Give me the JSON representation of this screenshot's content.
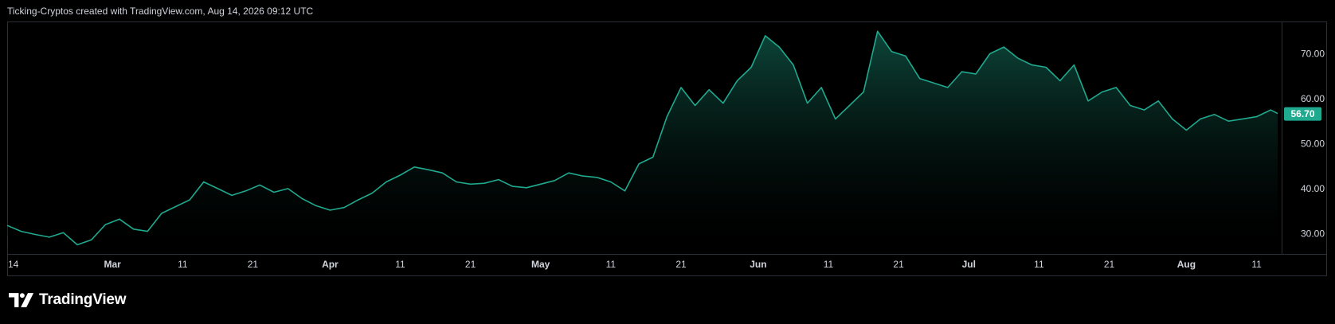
{
  "header": {
    "caption": "Ticking-Cryptos created with TradingView.com, Aug 14, 2026 09:12 UTC"
  },
  "brand": {
    "name": "TradingView",
    "logo_icon": "tradingview-logo-icon"
  },
  "colors": {
    "background": "#000000",
    "line": "#1fa98f",
    "fill_top": "#0d4a3d",
    "fill_bottom": "#000000",
    "axis_text": "#d1d4dc",
    "price_label_bg": "#1fa98f",
    "price_label_text": "#ffffff",
    "frame": "#2a2e39"
  },
  "chart_data": {
    "type": "area",
    "title": "",
    "xlabel": "",
    "ylabel": "",
    "x_range": [
      "2026-02-14",
      "2026-08-14"
    ],
    "ylim": [
      26,
      77
    ],
    "grid": false,
    "legend": "none",
    "price_scale_side": "right",
    "last_price_label": "56.70",
    "x_tick_labels": [
      {
        "date": "2026-02-14",
        "label": "14"
      },
      {
        "date": "2026-03-01",
        "label": "Mar"
      },
      {
        "date": "2026-03-11",
        "label": "11"
      },
      {
        "date": "2026-03-21",
        "label": "21"
      },
      {
        "date": "2026-04-01",
        "label": "Apr"
      },
      {
        "date": "2026-04-11",
        "label": "11"
      },
      {
        "date": "2026-04-21",
        "label": "21"
      },
      {
        "date": "2026-05-01",
        "label": "May"
      },
      {
        "date": "2026-05-11",
        "label": "11"
      },
      {
        "date": "2026-05-21",
        "label": "21"
      },
      {
        "date": "2026-06-01",
        "label": "Jun"
      },
      {
        "date": "2026-06-11",
        "label": "11"
      },
      {
        "date": "2026-06-21",
        "label": "21"
      },
      {
        "date": "2026-07-01",
        "label": "Jul"
      },
      {
        "date": "2026-07-11",
        "label": "11"
      },
      {
        "date": "2026-07-21",
        "label": "21"
      },
      {
        "date": "2026-08-01",
        "label": "Aug"
      },
      {
        "date": "2026-08-11",
        "label": "11"
      }
    ],
    "y_tick_labels": [
      {
        "value": 70,
        "label": "70.00"
      },
      {
        "value": 60,
        "label": "60.00"
      },
      {
        "value": 50,
        "label": "50.00"
      },
      {
        "value": 40,
        "label": "40.00"
      },
      {
        "value": 30,
        "label": "30.00"
      }
    ],
    "series": [
      {
        "x": [
          "2026-02-14",
          "2026-02-16",
          "2026-02-18",
          "2026-02-20",
          "2026-02-22",
          "2026-02-24",
          "2026-02-26",
          "2026-02-28",
          "2026-03-02",
          "2026-03-04",
          "2026-03-06",
          "2026-03-08",
          "2026-03-10",
          "2026-03-12",
          "2026-03-14",
          "2026-03-16",
          "2026-03-18",
          "2026-03-20",
          "2026-03-22",
          "2026-03-24",
          "2026-03-26",
          "2026-03-28",
          "2026-03-30",
          "2026-04-01",
          "2026-04-03",
          "2026-04-05",
          "2026-04-07",
          "2026-04-09",
          "2026-04-11",
          "2026-04-13",
          "2026-04-15",
          "2026-04-17",
          "2026-04-19",
          "2026-04-21",
          "2026-04-23",
          "2026-04-25",
          "2026-04-27",
          "2026-04-29",
          "2026-05-01",
          "2026-05-03",
          "2026-05-05",
          "2026-05-07",
          "2026-05-09",
          "2026-05-11",
          "2026-05-13",
          "2026-05-15",
          "2026-05-17",
          "2026-05-19",
          "2026-05-21",
          "2026-05-23",
          "2026-05-25",
          "2026-05-27",
          "2026-05-29",
          "2026-05-31",
          "2026-06-02",
          "2026-06-04",
          "2026-06-06",
          "2026-06-08",
          "2026-06-10",
          "2026-06-12",
          "2026-06-14",
          "2026-06-16",
          "2026-06-18",
          "2026-06-20",
          "2026-06-22",
          "2026-06-24",
          "2026-06-26",
          "2026-06-28",
          "2026-06-30",
          "2026-07-02",
          "2026-07-04",
          "2026-07-06",
          "2026-07-08",
          "2026-07-10",
          "2026-07-12",
          "2026-07-14",
          "2026-07-16",
          "2026-07-18",
          "2026-07-20",
          "2026-07-22",
          "2026-07-24",
          "2026-07-26",
          "2026-07-28",
          "2026-07-30",
          "2026-08-01",
          "2026-08-03",
          "2026-08-05",
          "2026-08-07",
          "2026-08-09",
          "2026-08-11",
          "2026-08-13",
          "2026-08-14"
        ],
        "values": [
          31.8,
          30.5,
          29.8,
          29.2,
          30.2,
          27.5,
          28.6,
          32.0,
          33.2,
          31.0,
          30.5,
          34.5,
          36.0,
          37.5,
          41.5,
          40.0,
          38.5,
          39.5,
          40.8,
          39.2,
          40.0,
          37.8,
          36.2,
          35.2,
          35.8,
          37.5,
          39.0,
          41.5,
          43.0,
          44.8,
          44.2,
          43.5,
          41.5,
          41.0,
          41.2,
          42.0,
          40.5,
          40.2,
          41.0,
          41.8,
          43.5,
          42.8,
          42.5,
          41.5,
          39.5,
          45.5,
          47.0,
          56.0,
          62.5,
          58.5,
          62.0,
          59.0,
          64.0,
          67.0,
          74.0,
          71.5,
          67.5,
          59.0,
          62.5,
          55.5,
          58.5,
          61.5,
          75.0,
          70.5,
          69.5,
          64.5,
          63.5,
          62.5,
          66.0,
          65.5,
          70.0,
          71.5,
          69.0,
          67.5,
          67.0,
          64.0,
          67.5,
          59.5,
          61.5,
          62.5,
          58.5,
          57.5,
          59.5,
          55.5,
          53.0,
          55.5,
          56.5,
          55.0,
          55.5,
          56.0,
          57.5,
          56.7
        ]
      }
    ]
  }
}
